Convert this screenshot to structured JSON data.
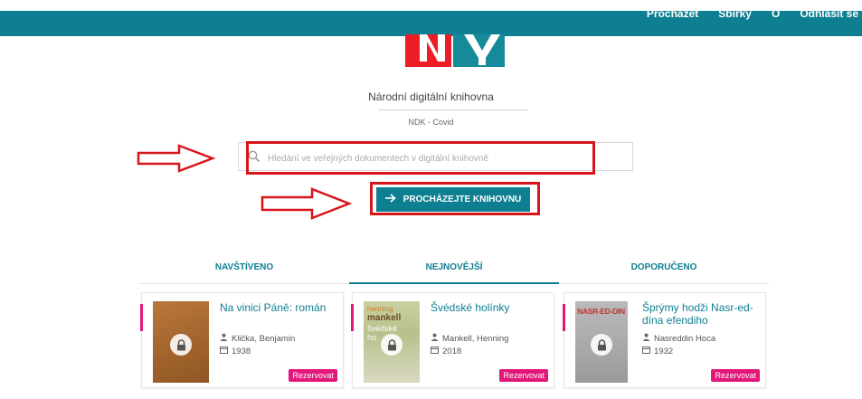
{
  "topnav": {
    "items": [
      "Procházet",
      "Sbírky",
      "O",
      "Odhlásit se"
    ]
  },
  "app": {
    "title": "Národní digitální knihovna",
    "subtitle": "NDK - Covid"
  },
  "search": {
    "placeholder": "Hledání ve veřejných dokumentech v digitální knihovně"
  },
  "browse_button": {
    "label": "PROCHÁZEJTE KNIHOVNU"
  },
  "tabs": [
    {
      "label": "NAVŠTÍVENO",
      "active": false
    },
    {
      "label": "NEJNOVĚJŠÍ",
      "active": true
    },
    {
      "label": "DOPORUČENO",
      "active": false
    }
  ],
  "cards": [
    {
      "title": "Na vinici Páně: román",
      "author": "Klička, Benjamin",
      "year": "1938",
      "action": "Rezervovat"
    },
    {
      "title": "Švédské holínky",
      "author": "Mankell, Henning",
      "year": "2018",
      "action": "Rezervovat",
      "cover_text": {
        "line1": "henning",
        "line2": "mankell",
        "line3": "švédské",
        "line4": "ho"
      }
    },
    {
      "title": "Šprýmy hodži Nasr-ed-dína efendiho",
      "author": "Nasreddin Hoca",
      "year": "1932",
      "action": "Rezervovat",
      "cover_text": {
        "line1": "NASR-ED-DIN"
      }
    }
  ],
  "colors": {
    "brand": "#0e7f91",
    "accent": "#e2177a",
    "annotation": "#d7161c",
    "logo_red": "#ee1c25",
    "logo_teal": "#178a9a"
  }
}
